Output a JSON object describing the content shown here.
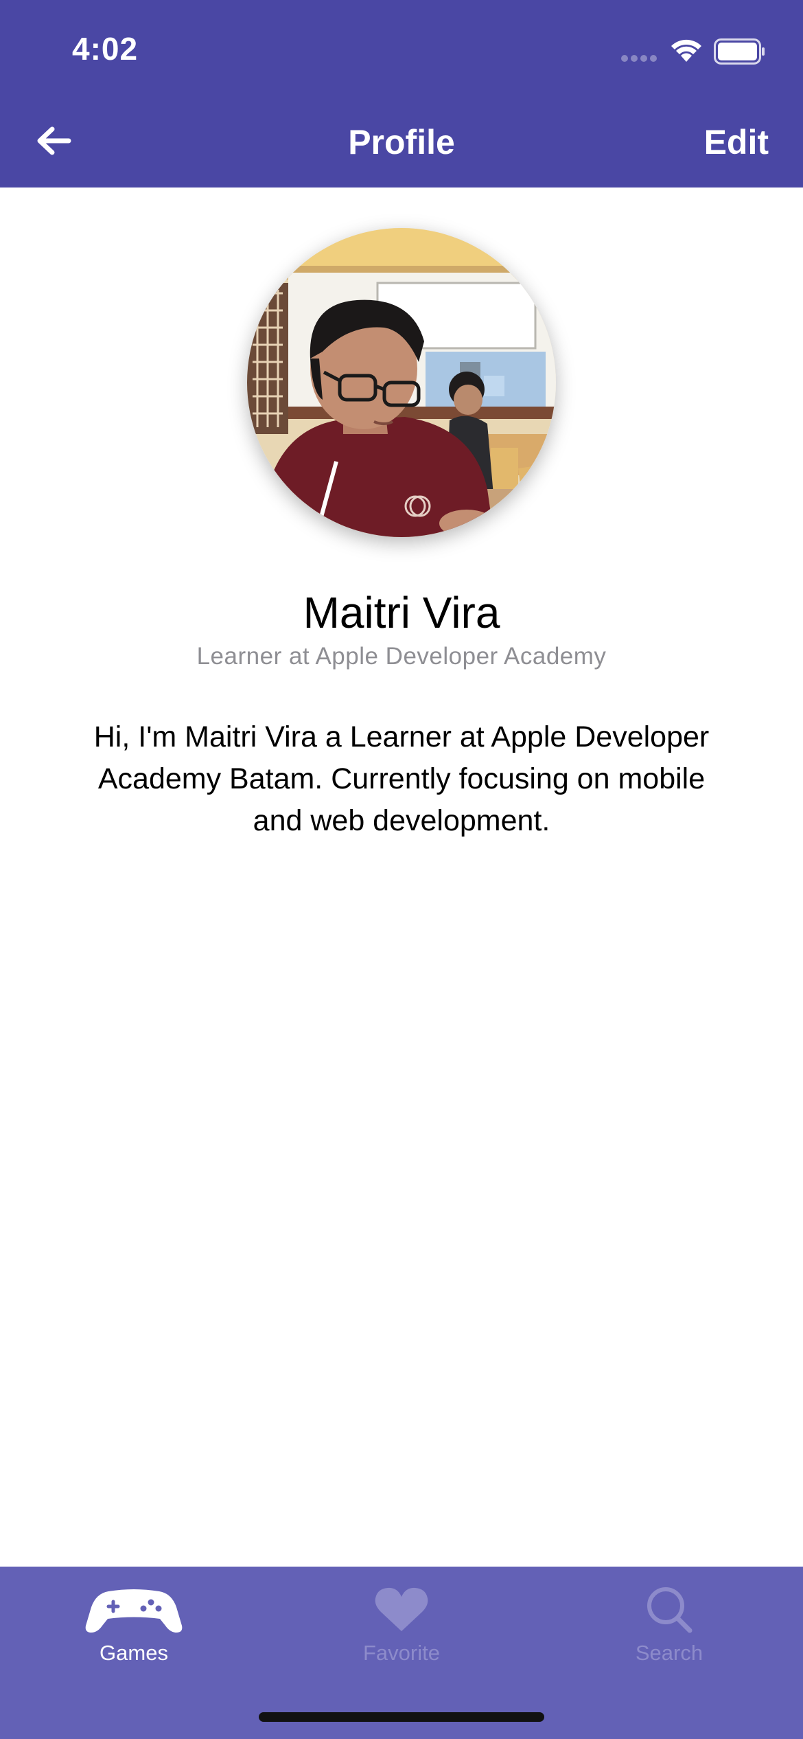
{
  "status_bar": {
    "time": "4:02"
  },
  "nav": {
    "title": "Profile",
    "edit_label": "Edit",
    "back_icon": "arrow-left-icon"
  },
  "profile": {
    "name": "Maitri Vira",
    "role": "Learner at Apple Developer Academy",
    "bio": "Hi, I'm Maitri Vira a Learner at Apple Developer Academy Batam. Currently focusing on mobile and web development."
  },
  "tabs": [
    {
      "label": "Games",
      "icon": "gamepad-icon",
      "active": true
    },
    {
      "label": "Favorite",
      "icon": "heart-icon",
      "active": false
    },
    {
      "label": "Search",
      "icon": "search-icon",
      "active": false
    }
  ],
  "colors": {
    "nav_background": "#4a47a4",
    "tab_background": "#6361b6",
    "tab_active": "#ffffff",
    "tab_inactive": "#8d8bcb"
  }
}
